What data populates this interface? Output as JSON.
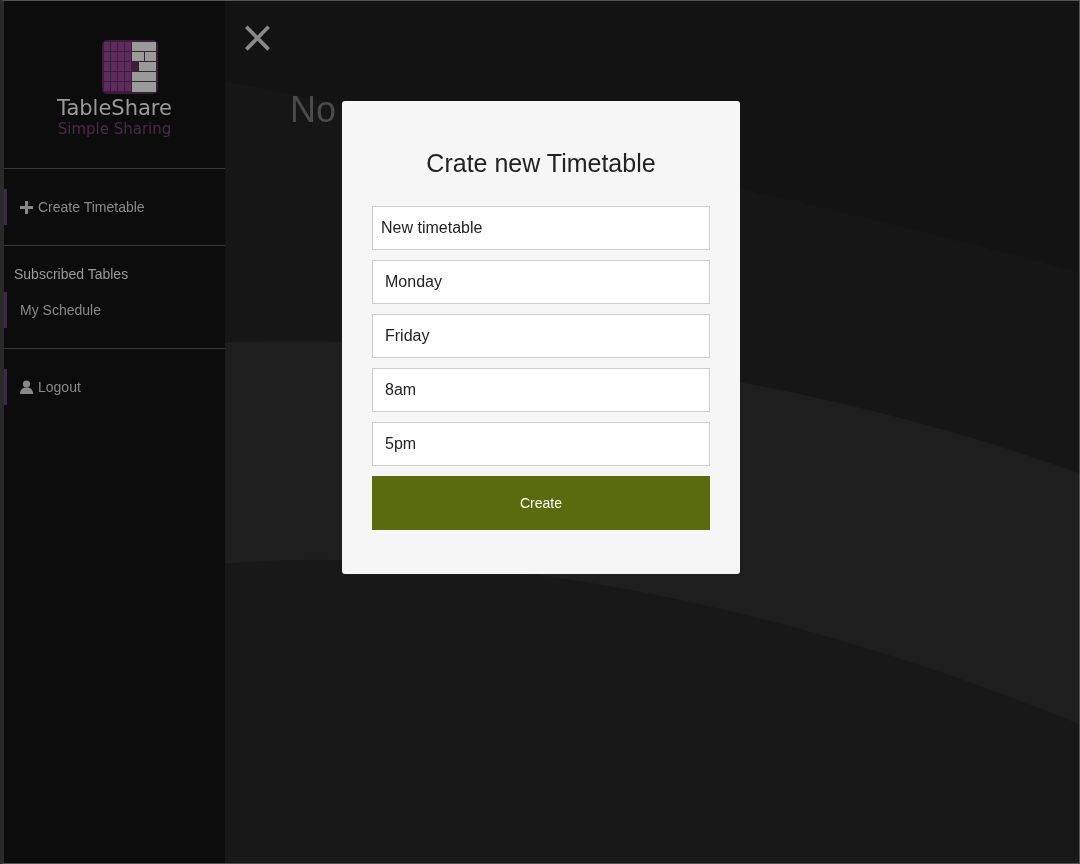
{
  "logo": {
    "name": "TableShare",
    "tagline": "Simple Sharing"
  },
  "sidebar": {
    "sections": [
      {
        "items": [
          {
            "label": "Create Timetable",
            "kind": "action"
          }
        ]
      },
      {
        "heading": "Subscribed Tables",
        "items": [
          {
            "label": "My Schedule",
            "kind": "table"
          }
        ]
      },
      {
        "items": [
          {
            "label": "Logout",
            "kind": "account"
          }
        ]
      }
    ]
  },
  "close": "×",
  "heading": "No",
  "dialog": {
    "title": "Crate new Timetable",
    "fields": [
      {
        "value": "New timetable"
      },
      {
        "value": "Monday"
      },
      {
        "value": "Friday"
      },
      {
        "value": "8am"
      },
      {
        "value": "5pm"
      }
    ],
    "button": "Create"
  }
}
